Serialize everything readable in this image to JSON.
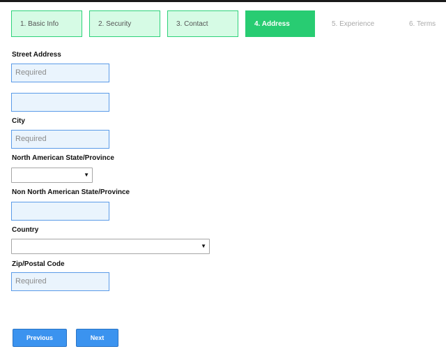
{
  "wizard": {
    "steps": [
      {
        "label": "1. Basic Info",
        "state": "done"
      },
      {
        "label": "2. Security",
        "state": "done"
      },
      {
        "label": "3. Contact",
        "state": "done"
      },
      {
        "label": "4. Address",
        "state": "active"
      },
      {
        "label": "5. Experience",
        "state": "todo"
      },
      {
        "label": "6. Terms",
        "state": "todo"
      }
    ]
  },
  "form": {
    "street_address": {
      "label": "Street Address",
      "line1_placeholder": "Required",
      "line2_value": ""
    },
    "city": {
      "label": "City",
      "placeholder": "Required"
    },
    "na_state": {
      "label": "North American State/Province",
      "selected": ""
    },
    "non_na_state": {
      "label": "Non North American State/Province",
      "value": ""
    },
    "country": {
      "label": "Country",
      "selected": ""
    },
    "zip": {
      "label": "Zip/Postal Code",
      "placeholder": "Required"
    }
  },
  "buttons": {
    "previous": "Previous",
    "next": "Next"
  },
  "colors": {
    "step_done_bg": "#d6fbe5",
    "step_active_bg": "#28cc72",
    "input_bg": "#eaf4fd",
    "input_border": "#5b9be8",
    "button_bg": "#3b93ef"
  },
  "icons": {
    "select_arrow": "▼"
  }
}
